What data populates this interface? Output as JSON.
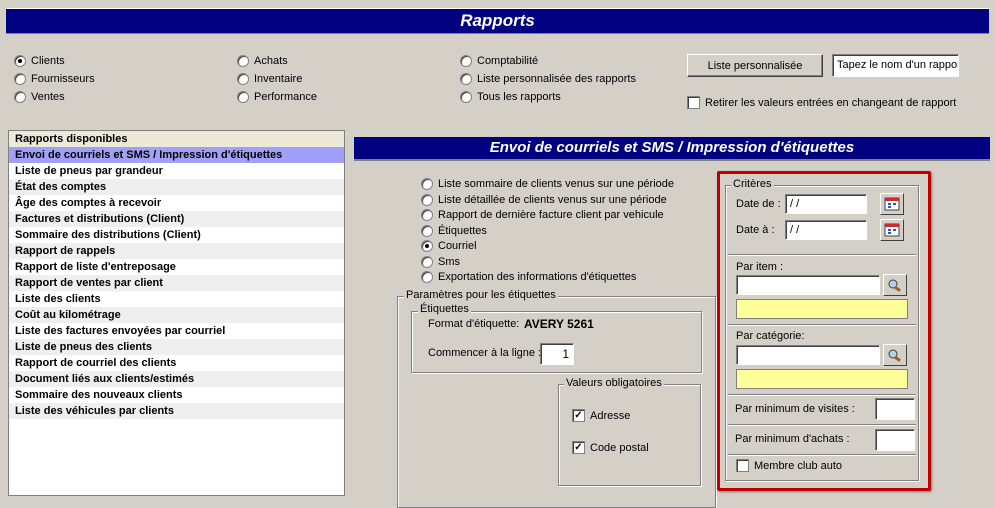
{
  "header": {
    "title": "Rapports"
  },
  "categories": {
    "col1": [
      {
        "label": "Clients",
        "selected": true
      },
      {
        "label": "Fournisseurs",
        "selected": false
      },
      {
        "label": "Ventes",
        "selected": false
      }
    ],
    "col2": [
      {
        "label": "Achats",
        "selected": false
      },
      {
        "label": "Inventaire",
        "selected": false
      },
      {
        "label": "Performance",
        "selected": false
      }
    ],
    "col3": [
      {
        "label": "Comptabilité",
        "selected": false
      },
      {
        "label": "Liste personnalisée des rapports",
        "selected": false
      },
      {
        "label": "Tous les rapports",
        "selected": false
      }
    ]
  },
  "custom": {
    "button_label": "Liste personnalisée",
    "name_value": "Tapez le nom d'un rapport",
    "clear_label": "Retirer les valeurs entrées en changeant de rapport"
  },
  "reports": {
    "header": "Rapports disponibles",
    "items": [
      "Envoi de courriels et SMS / Impression d'étiquettes",
      "Liste de pneus par grandeur",
      "État des comptes",
      "Âge des comptes à recevoir",
      "Factures et distributions (Client)",
      "Sommaire des distributions (Client)",
      "Rapport de rappels",
      "Rapport de liste d'entreposage",
      "Rapport de ventes par client",
      "Liste des clients",
      "Coût au kilométrage",
      "Liste des factures envoyées par courriel",
      "Liste de pneus des clients",
      "Rapport de courriel des clients",
      "Document liés aux clients/estimés",
      "Sommaire des nouveaux clients",
      "Liste des véhicules par clients"
    ]
  },
  "detail": {
    "title": "Envoi de courriels et SMS / Impression d'étiquettes",
    "options": [
      {
        "label": "Liste sommaire de clients venus sur une période",
        "selected": false
      },
      {
        "label": "Liste détaillée de clients venus sur une période",
        "selected": false
      },
      {
        "label": "Rapport de dernière facture client par vehicule",
        "selected": false
      },
      {
        "label": "Étiquettes",
        "selected": false
      },
      {
        "label": "Courriel",
        "selected": true
      },
      {
        "label": "Sms",
        "selected": false
      },
      {
        "label": "Exportation des informations d'étiquettes",
        "selected": false
      }
    ]
  },
  "labels_params": {
    "legend": "Paramètres pour les étiquettes",
    "etiquettes_legend": "Étiquettes",
    "format_label": "Format d'étiquette:",
    "format_value": "AVERY 5261",
    "start_line_label": "Commencer à la ligne :",
    "start_line_value": "1",
    "mandatory_legend": "Valeurs obligatoires",
    "address_label": "Adresse",
    "postal_label": "Code postal"
  },
  "criteria": {
    "legend": "Critères",
    "date_from_label": "Date de :",
    "date_from_value": " / /",
    "date_to_label": "Date à :",
    "date_to_value": " / /",
    "by_item_label": "Par item :",
    "by_category_label": "Par catégorie:",
    "min_visits_label": "Par minimum de visites :",
    "min_purchases_label": "Par minimum d'achats :",
    "club_label": "Membre club auto"
  },
  "colors": {
    "title_bar": "#000080",
    "selection": "#a0a0f8",
    "highlight_border": "#c00000",
    "yellow_field": "#ffff99"
  }
}
